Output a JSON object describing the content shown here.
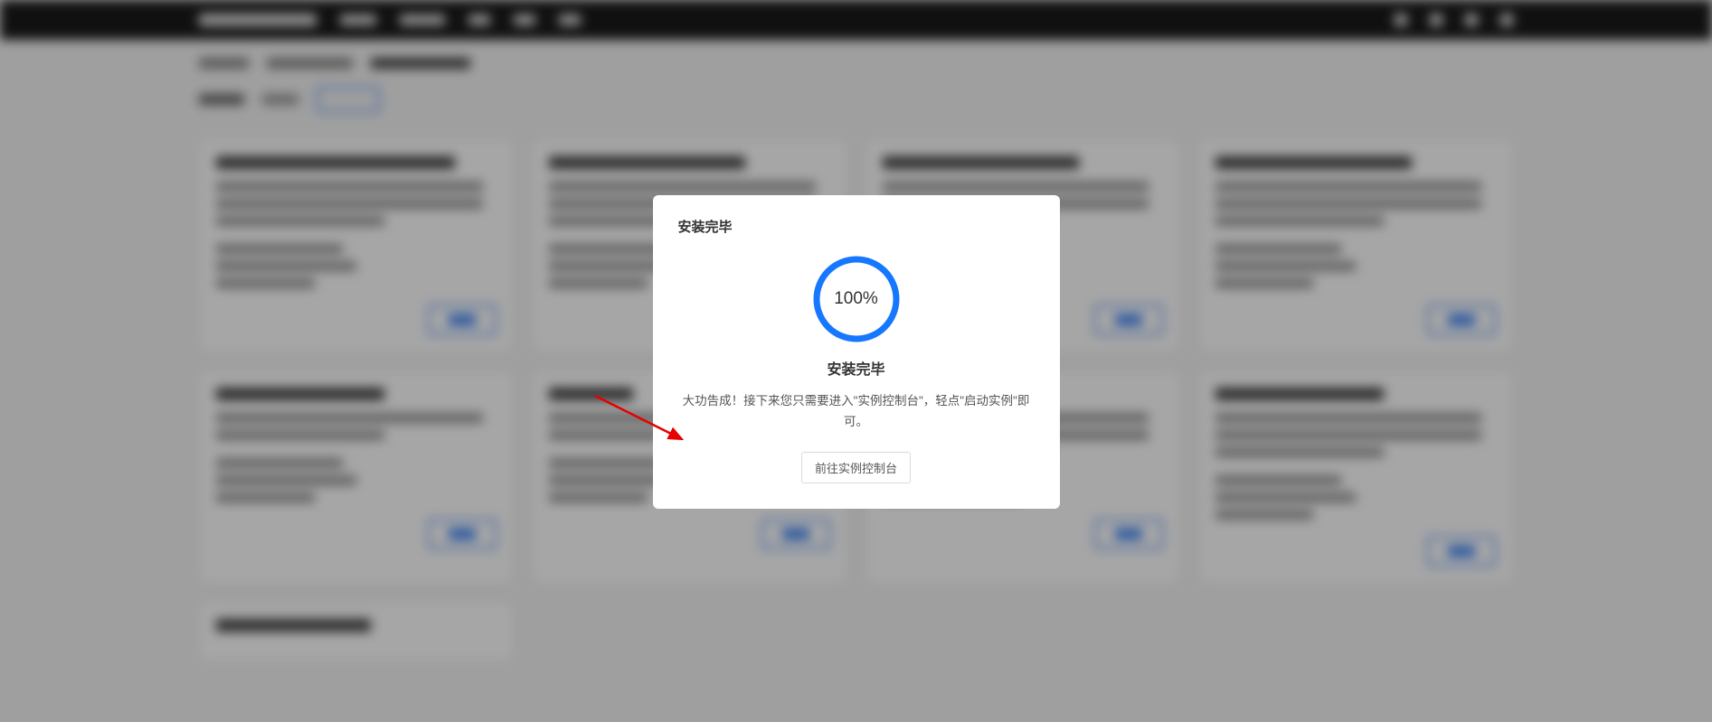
{
  "modal": {
    "title": "安装完毕",
    "progress_percent": "100%",
    "heading": "安装完毕",
    "description": "大功告成！接下来您只需要进入\"实例控制台\"，轻点\"启动实例\"即可。",
    "button_label": "前往实例控制台"
  },
  "colors": {
    "progress_ring": "#1677ff",
    "arrow": "#e60000"
  }
}
